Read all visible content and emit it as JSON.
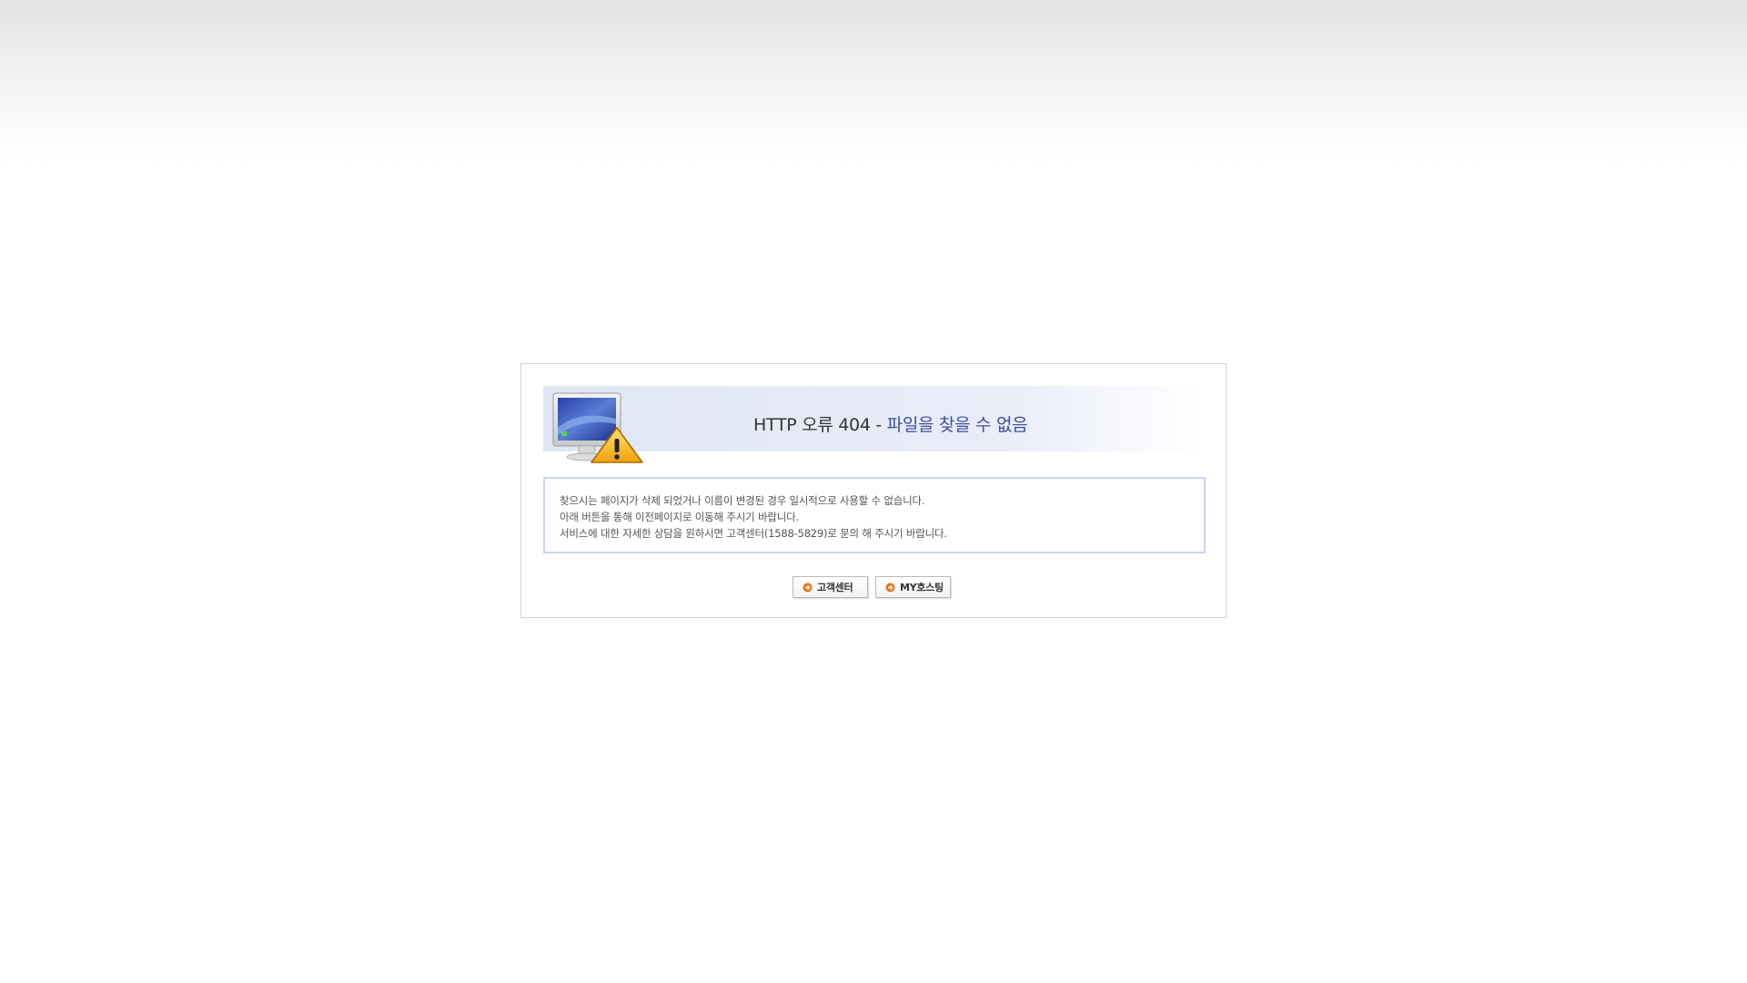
{
  "header": {
    "title_prefix": "HTTP 오류 404 - ",
    "title_accent": "파일을 찾을 수 없음"
  },
  "message": {
    "lines": [
      "찾으시는 페이지가 삭제 되었거나 이름이 변경된 경우 일시적으로 사용할 수 없습니다.",
      "아래 버튼을 통해 이전페이지로 이동해 주시기 바랍니다.",
      "서비스에 대한 자세한 상담을 원하시면 고객센터(1588-5829)로 문의 해 주시기 바랍니다."
    ]
  },
  "buttons": {
    "support_label": "고객센터",
    "myhosting_label": "MY호스팅"
  },
  "icons": {
    "main": "computer-warning-icon",
    "button_bullet": "arrow-circle-icon"
  },
  "colors": {
    "accent": "#3e4f9e",
    "band": "#e1e6f5",
    "message_border": "#cdd5ee",
    "bullet": "#e8731e"
  }
}
